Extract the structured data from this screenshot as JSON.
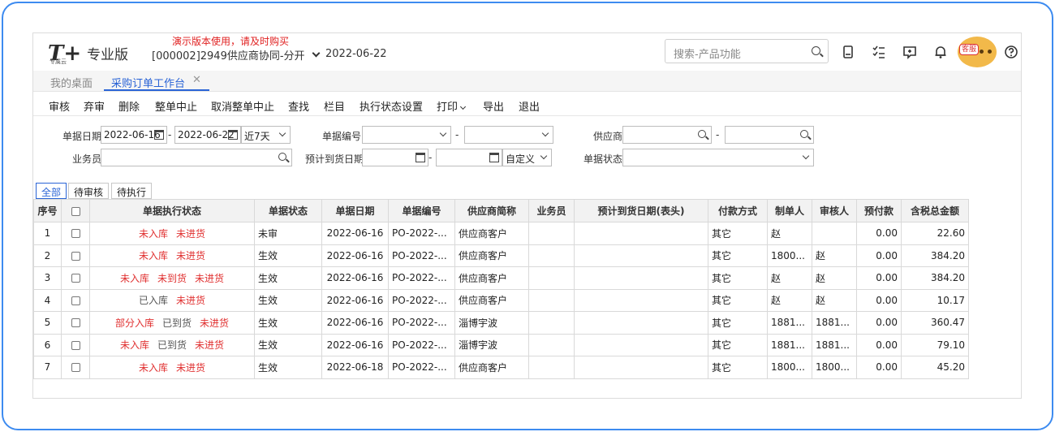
{
  "header": {
    "logo_text": "T+",
    "logo_sub": "专属云",
    "edition": "专业版",
    "demo_notice": "演示版本使用，请及时购买",
    "company": "[000002]2949供应商协同-分开",
    "date": "2022-06-22",
    "search_placeholder": "搜索-产品功能",
    "icons": [
      "calculator-icon",
      "checklist-icon",
      "message-icon",
      "bell-icon",
      "service-avatar",
      "help-icon"
    ],
    "avatar_badge": "客服"
  },
  "tabs": [
    {
      "label": "我的桌面",
      "active": false
    },
    {
      "label": "采购订单工作台",
      "active": true
    }
  ],
  "toolbar": [
    "审核",
    "弃审",
    "删除",
    "整单中止",
    "取消整单中止",
    "查找",
    "栏目",
    "执行状态设置",
    "打印",
    "导出",
    "退出"
  ],
  "filters": {
    "doc_date_label": "单据日期",
    "doc_date_from": "2022-06-16",
    "doc_date_to": "2022-06-22",
    "doc_date_range": "近7天",
    "doc_no_label": "单据编号",
    "supplier_label": "供应商",
    "salesman_label": "业务员",
    "arrival_date_label": "预计到货日期",
    "arrival_date_range": "自定义",
    "doc_status_label": "单据状态"
  },
  "view_tabs": [
    {
      "label": "全部",
      "active": true
    },
    {
      "label": "待审核",
      "active": false
    },
    {
      "label": "待执行",
      "active": false
    }
  ],
  "table": {
    "columns": [
      "序号",
      "",
      "单据执行状态",
      "单据状态",
      "单据日期",
      "单据编号",
      "供应商简称",
      "业务员",
      "预计到货日期(表头)",
      "付款方式",
      "制单人",
      "审核人",
      "预付款",
      "含税总金额"
    ],
    "rows": [
      {
        "no": "1",
        "exec": [
          {
            "t": "未入库",
            "c": "red"
          },
          {
            "t": "未进货",
            "c": "red"
          }
        ],
        "status": "未审",
        "date": "2022-06-16",
        "code": "PO-2022-...",
        "supplier": "供应商客户",
        "salesman": "",
        "arrival": "",
        "pay": "其它",
        "maker": "赵",
        "auditor": "",
        "prepay": "0.00",
        "total": "22.60"
      },
      {
        "no": "2",
        "exec": [
          {
            "t": "未入库",
            "c": "red"
          },
          {
            "t": "未进货",
            "c": "red"
          }
        ],
        "status": "生效",
        "date": "2022-06-16",
        "code": "PO-2022-...",
        "supplier": "供应商客户",
        "salesman": "",
        "arrival": "",
        "pay": "其它",
        "maker": "1800...",
        "auditor": "赵",
        "prepay": "0.00",
        "total": "384.20"
      },
      {
        "no": "3",
        "exec": [
          {
            "t": "未入库",
            "c": "red"
          },
          {
            "t": "未到货",
            "c": "red"
          },
          {
            "t": "未进货",
            "c": "red"
          }
        ],
        "status": "生效",
        "date": "2022-06-16",
        "code": "PO-2022-...",
        "supplier": "供应商客户",
        "salesman": "",
        "arrival": "",
        "pay": "其它",
        "maker": "赵",
        "auditor": "赵",
        "prepay": "0.00",
        "total": "384.20"
      },
      {
        "no": "4",
        "exec": [
          {
            "t": "已入库",
            "c": "gray"
          },
          {
            "t": "未进货",
            "c": "red"
          }
        ],
        "status": "生效",
        "date": "2022-06-16",
        "code": "PO-2022-...",
        "supplier": "供应商客户",
        "salesman": "",
        "arrival": "",
        "pay": "其它",
        "maker": "赵",
        "auditor": "赵",
        "prepay": "0.00",
        "total": "10.17"
      },
      {
        "no": "5",
        "exec": [
          {
            "t": "部分入库",
            "c": "red"
          },
          {
            "t": "已到货",
            "c": "gray"
          },
          {
            "t": "未进货",
            "c": "red"
          }
        ],
        "status": "生效",
        "date": "2022-06-16",
        "code": "PO-2022-...",
        "supplier": "淄博宇波",
        "salesman": "",
        "arrival": "",
        "pay": "其它",
        "maker": "1881...",
        "auditor": "1881...",
        "prepay": "0.00",
        "total": "360.47"
      },
      {
        "no": "6",
        "exec": [
          {
            "t": "未入库",
            "c": "red"
          },
          {
            "t": "已到货",
            "c": "gray"
          },
          {
            "t": "未进货",
            "c": "red"
          }
        ],
        "status": "生效",
        "date": "2022-06-16",
        "code": "PO-2022-...",
        "supplier": "淄博宇波",
        "salesman": "",
        "arrival": "",
        "pay": "其它",
        "maker": "1881...",
        "auditor": "1881...",
        "prepay": "0.00",
        "total": "79.10"
      },
      {
        "no": "7",
        "exec": [
          {
            "t": "未入库",
            "c": "red"
          },
          {
            "t": "未进货",
            "c": "red"
          }
        ],
        "status": "生效",
        "date": "2022-06-18",
        "code": "PO-2022-...",
        "supplier": "供应商客户",
        "salesman": "",
        "arrival": "",
        "pay": "其它",
        "maker": "1800...",
        "auditor": "1800...",
        "prepay": "0.00",
        "total": "45.20"
      }
    ]
  }
}
